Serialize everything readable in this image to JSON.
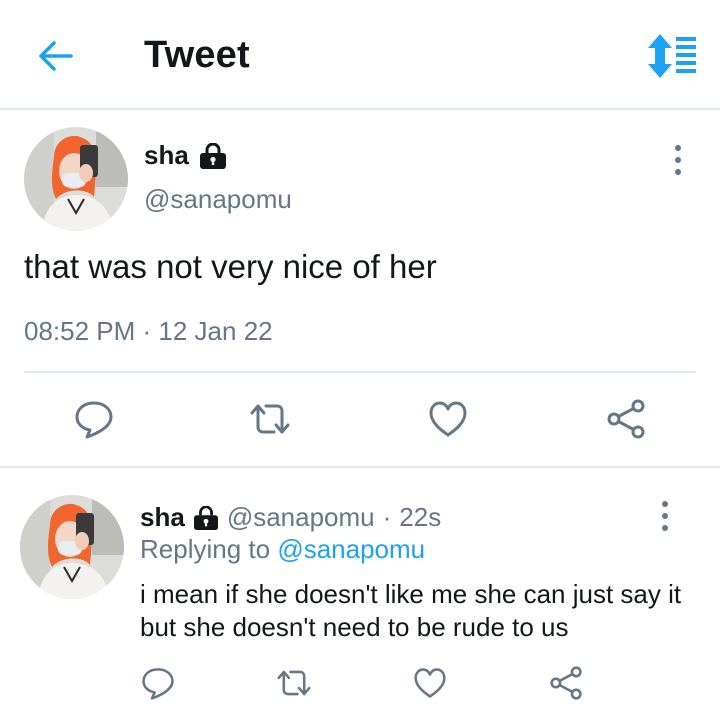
{
  "header": {
    "title": "Tweet",
    "back_icon": "back-arrow-icon",
    "sort_icon": "sort-icon"
  },
  "tweet": {
    "name": "sha",
    "handle": "@sanapomu",
    "text": "that was not very nice of her",
    "time": "08:52 PM",
    "separator": " · ",
    "date": "12 Jan 22",
    "actions": [
      "reply-icon",
      "retweet-icon",
      "like-icon",
      "share-icon"
    ]
  },
  "reply": {
    "name": "sha",
    "handle": "@sanapomu",
    "separator": "·",
    "age": "22s",
    "replying_prefix": "Replying to",
    "replying_to": "@sanapomu",
    "text": "i mean if she doesn't like me she can just say it but she doesn't need to be rude to us"
  },
  "colors": {
    "accent": "#1da1f2",
    "secondary_text": "#657786",
    "divider": "#e1e8ed",
    "avatar_hair": "#f2652e"
  }
}
